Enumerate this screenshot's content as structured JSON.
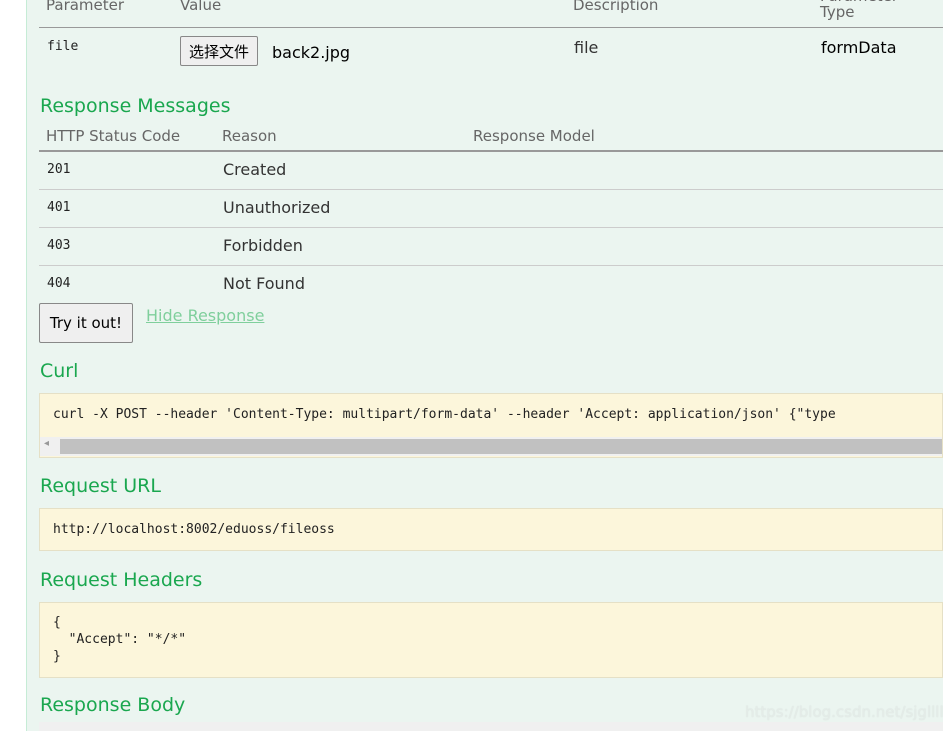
{
  "parameters": {
    "headers": [
      "Parameter",
      "Value",
      "Description",
      "Parameter Type"
    ],
    "row": {
      "name": "file",
      "file_button": "选择文件",
      "file_name": "back2.jpg",
      "description": "file",
      "type": "formData"
    }
  },
  "response_messages": {
    "title": "Response Messages",
    "headers": [
      "HTTP Status Code",
      "Reason",
      "Response Model"
    ],
    "rows": [
      {
        "code": "201",
        "reason": "Created"
      },
      {
        "code": "401",
        "reason": "Unauthorized"
      },
      {
        "code": "403",
        "reason": "Forbidden"
      },
      {
        "code": "404",
        "reason": "Not Found"
      }
    ]
  },
  "actions": {
    "try_label": "Try it out!",
    "hide_label": "Hide Response"
  },
  "curl": {
    "title": "Curl",
    "command": "curl -X POST --header 'Content-Type: multipart/form-data' --header 'Accept: application/json' {\"type"
  },
  "request_url": {
    "title": "Request URL",
    "value": "http://localhost:8002/eduoss/fileoss"
  },
  "request_headers": {
    "title": "Request Headers",
    "lines": [
      "{",
      "  \"Accept\": \"*/*\"",
      "}"
    ]
  },
  "response_body": {
    "title": "Response Body"
  },
  "watermark": "https://blog.csdn.net/sjglllllll"
}
